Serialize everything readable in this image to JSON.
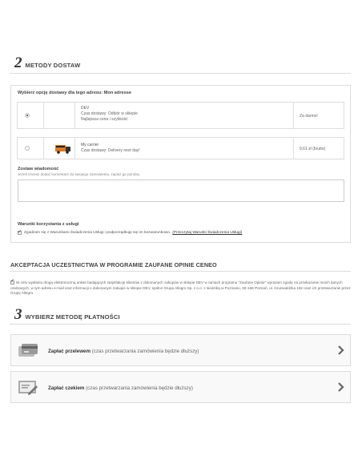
{
  "delivery": {
    "step_number": "2",
    "title": "METODY DOSTAW",
    "subtitle": "Wybierz opcję dostawy dla tego adresu: Mon adresse",
    "options": [
      {
        "name": "DEV",
        "line1": "Czas dostawy: Odbiór w sklepie",
        "line2": "Najlepsza cena i szybkość",
        "price": "Za darmo!",
        "selected": true
      },
      {
        "name": "My carrier",
        "line1": "Czas dostawy: Delivery next day!",
        "line2": "",
        "price": "9,61 zł (brutto)",
        "selected": false
      }
    ],
    "message_label": "Zostaw wiadomość",
    "message_hint": "Jeżeli chcesz dodać komentarz do swojego zamówienia, zapisz go poniżej.",
    "message_value": "",
    "terms_label": "Warunki korzystania z usługi",
    "terms_text": "Zgadzam się z Warunkami Świadczenia Usługi i podporządkuję się im bezwarunkowo.",
    "terms_link": "(Przeczytaj Warunki Świadczenia Usługi)",
    "terms_checked": true
  },
  "ceneo": {
    "title": "AKCEPTACJA UCZESTNICTWA W PROGRAMIE ZAUFANE OPINIE CENEO",
    "text": "W celu wysłania drogą elektroniczną ankiet badających satysfakcję klientów z dokonanych zakupów w sklepie DEV w ramach programu \"Zaufane Opinie\" wyrażam zgodę na przekazanie moich danych osobowych, w tym adresu e-mail oraz informacji o dokonanym zakupie w sklepie DEV, spółce Grupa Allegro Sp. z o.o. z siedzibą w Poznaniu, 60-166 Poznań, ul. Grunwaldzka 182 oraz ich przetwarzanie przez Grupę Allegro.",
    "checked": true
  },
  "payment": {
    "step_number": "3",
    "title": "WYBIERZ METODĘ PŁATNOŚCI",
    "methods": [
      {
        "bold": "Zapłać przelewem",
        "note": " (czas przetwarzania zamówienia będzie dłuższy)",
        "icon": "bank-card-icon"
      },
      {
        "bold": "Zapłać czekiem",
        "note": " (czas przetwarzania zamówienia będzie dłuższy)",
        "icon": "cheque-icon"
      }
    ]
  }
}
